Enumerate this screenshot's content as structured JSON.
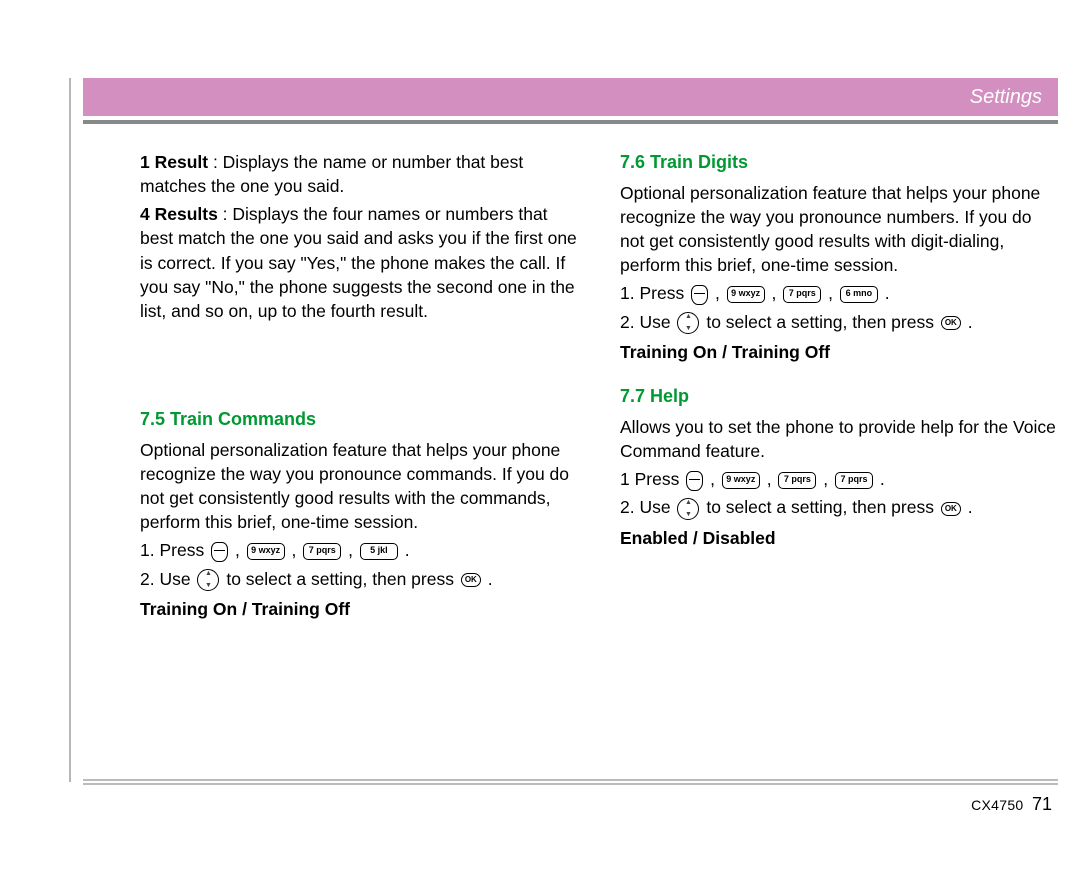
{
  "header": {
    "title": "Settings"
  },
  "left": {
    "result1_label": "1 Result",
    "result1_text": " : Displays the name or number that best matches the one you said.",
    "result4_label": "4 Results",
    "result4_text": " : Displays the four names or numbers that best match the one you said and asks you if the first one is correct. If you say \"Yes,\" the phone makes the call. If you say \"No,\" the phone suggests the second one in the list, and so on, up to the fourth result.",
    "h_7_5": "7.5 Train Commands",
    "p_7_5": "Optional personalization feature that helps your phone recognize the way you pronounce commands. If you do not get consistently good results with the commands, perform this brief, one-time session.",
    "step1_pre": "1. Press ",
    "step2_pre": "2. Use ",
    "step2_mid": " to select a setting, then press ",
    "keys_7_5": [
      "9 wxyz",
      "7 pqrs",
      "5 jkl"
    ],
    "setting_7_5": "Training On / Training Off"
  },
  "right": {
    "h_7_6": "7.6 Train Digits",
    "p_7_6": "Optional personalization feature that helps your phone recognize the way you pronounce numbers. If you do not get consistently good results with digit-dialing, perform this brief, one-time session.",
    "keys_7_6": [
      "9 wxyz",
      "7 pqrs",
      "6 mno"
    ],
    "setting_7_6": "Training On / Training Off",
    "h_7_7": "7.7 Help",
    "p_7_7": "Allows you to set the phone to provide help for the Voice Command feature.",
    "step1_pre_7_7": "1 Press ",
    "keys_7_7": [
      "9 wxyz",
      "7 pqrs",
      "7 pqrs"
    ],
    "setting_7_7": "Enabled / Disabled"
  },
  "shared": {
    "step2_pre": "2. Use ",
    "step2_mid": " to select a setting, then press ",
    "period": " .",
    "comma": " , "
  },
  "footer": {
    "model": "CX4750",
    "page": "71"
  },
  "icons": {
    "menu": "menu-key",
    "nav": "nav-ring",
    "ok": "OK"
  }
}
